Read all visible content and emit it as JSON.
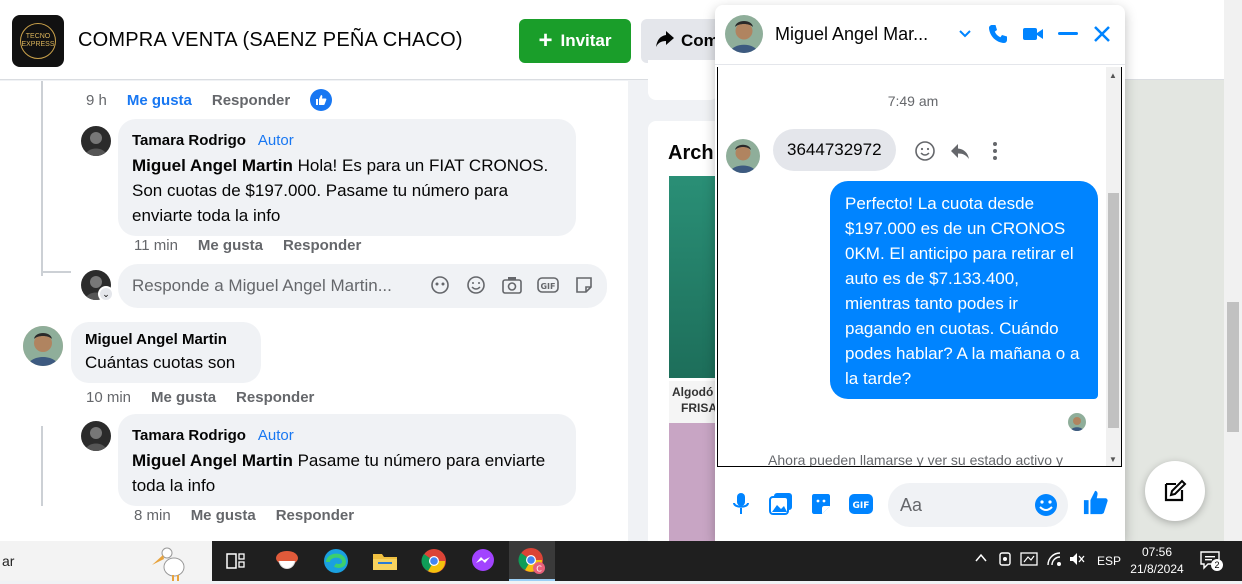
{
  "group": {
    "title": "COMPRA VENTA (SAENZ PEÑA CHACO)",
    "logo_text": "TECNO EXPRESS",
    "invite_label": "Invitar",
    "share_label": "Com"
  },
  "feed": {
    "top_meta": {
      "time": "9 h",
      "like": "Me gusta",
      "reply": "Responder"
    },
    "comment1": {
      "author": "Tamara Rodrigo",
      "badge": "Autor",
      "mention": "Miguel Angel Martin",
      "text": " Hola! Es para un FIAT CRONOS. Son cuotas de $197.000. Pasame tu número para enviarte toda la info",
      "time": "11 min",
      "like": "Me gusta",
      "reply": "Responder"
    },
    "reply_box": {
      "placeholder": "Responde a Miguel Angel Martin..."
    },
    "comment2": {
      "author": "Miguel Angel Martin",
      "text": "Cuántas cuotas son",
      "time": "10 min",
      "like": "Me gusta",
      "reply": "Responder"
    },
    "comment3": {
      "author": "Tamara Rodrigo",
      "badge": "Autor",
      "mention": "Miguel Angel Martin",
      "text": " Pasame tu número para enviarte toda la info",
      "time": "8 min",
      "like": "Me gusta",
      "reply": "Responder"
    }
  },
  "right_column": {
    "title": "Archi",
    "img_label_1": "Algodó",
    "img_label_2": "FRISA"
  },
  "chat": {
    "name": "Miguel Angel Mar...",
    "time": "7:49 am",
    "incoming": "3644732972",
    "outgoing": "Perfecto! La cuota desde $197.000 es de un CRONOS 0KM. El anticipo para retirar el auto es de $7.133.400, mientras tanto podes ir pagando en cuotas. Cuándo podes hablar? A la mañana o a la tarde?",
    "notice": "Ahora pueden llamarse y ver su estado activo y",
    "input_placeholder": "Aa"
  },
  "taskbar": {
    "search_text": "ar",
    "lang": "ESP",
    "time": "07:56",
    "date": "21/8/2024",
    "notif_count": "2"
  },
  "colors": {
    "facebook_blue": "#1877f2",
    "messenger_blue": "#0084ff",
    "invite_green": "#1a9e2a"
  }
}
